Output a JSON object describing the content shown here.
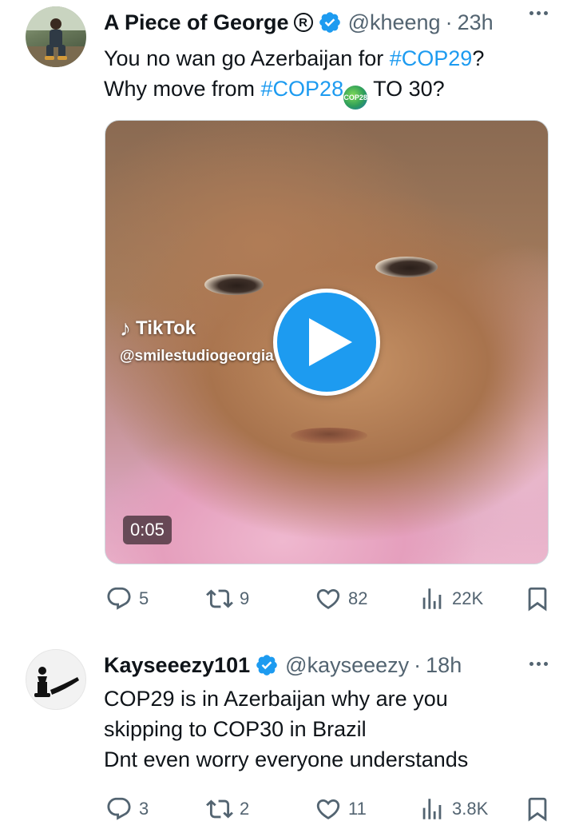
{
  "tweets": [
    {
      "name": "A Piece of George",
      "badge_letter": "R",
      "handle": "@kheeng",
      "time": "23h",
      "text_line1_prefix": "You no wan go Azerbaijan for ",
      "text_line1_tag": "#COP29",
      "text_line1_suffix": "?",
      "text_line2_prefix": "Why move from ",
      "text_line2_tag": "#COP28",
      "emoji_label": "COP28",
      "text_line2_suffix": " TO 30?",
      "media": {
        "tiktok_label": "TikTok",
        "tiktok_user": "@smilestudiogeorgia",
        "duration": "0:05"
      },
      "actions": {
        "replies": "5",
        "reposts": "9",
        "likes": "82",
        "views": "22K"
      }
    },
    {
      "name": "Kayseeezy101",
      "handle": "@kayseeezy",
      "time": "18h",
      "text_line1": "COP29 is in Azerbaijan why are you",
      "text_line2": "skipping to COP30 in Brazil",
      "text_line3": "Dnt even worry everyone understands",
      "actions": {
        "replies": "3",
        "reposts": "2",
        "likes": "11",
        "views": "3.8K"
      }
    }
  ],
  "separator": "·",
  "colors": {
    "accent": "#1d9bf0",
    "muted": "#536471",
    "text": "#0f1419"
  },
  "icons": [
    "verified-icon",
    "more-icon",
    "reply-icon",
    "repost-icon",
    "like-icon",
    "views-icon",
    "bookmark-icon",
    "play-icon",
    "tiktok-icon"
  ]
}
